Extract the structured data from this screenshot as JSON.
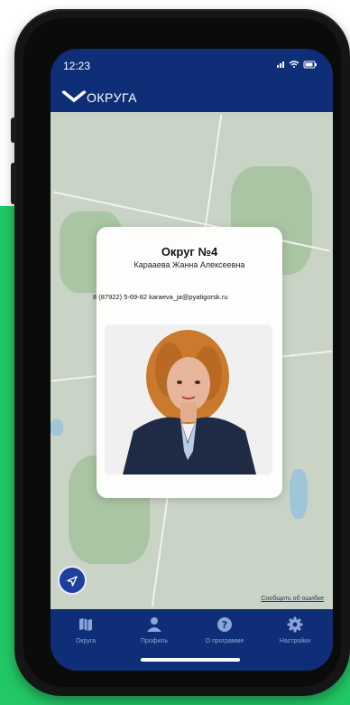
{
  "status_bar": {
    "time": "12:23",
    "icons": "signal wifi battery"
  },
  "app_bar": {
    "title": "ОКРУГА",
    "back_icon": "chevron-down-icon"
  },
  "popup": {
    "title": "Округ №4",
    "name": "Карааева Жанна Алексеевна",
    "contact": "8 (87922) 5-69-82 karaeva_ja@pyatigorsk.ru"
  },
  "map": {
    "attribution": "Сообщить об ошибке"
  },
  "tab_bar": {
    "items": [
      {
        "label": "Округа",
        "icon": "map-icon"
      },
      {
        "label": "Профиль",
        "icon": "person-icon"
      },
      {
        "label": "О программе",
        "icon": "question-icon"
      },
      {
        "label": "Настройки",
        "icon": "gear-icon"
      }
    ]
  },
  "colors": {
    "accent": "#0e2f78",
    "background": "#22c866",
    "map": "#c9d3c6",
    "locate": "#1e3f9e"
  }
}
